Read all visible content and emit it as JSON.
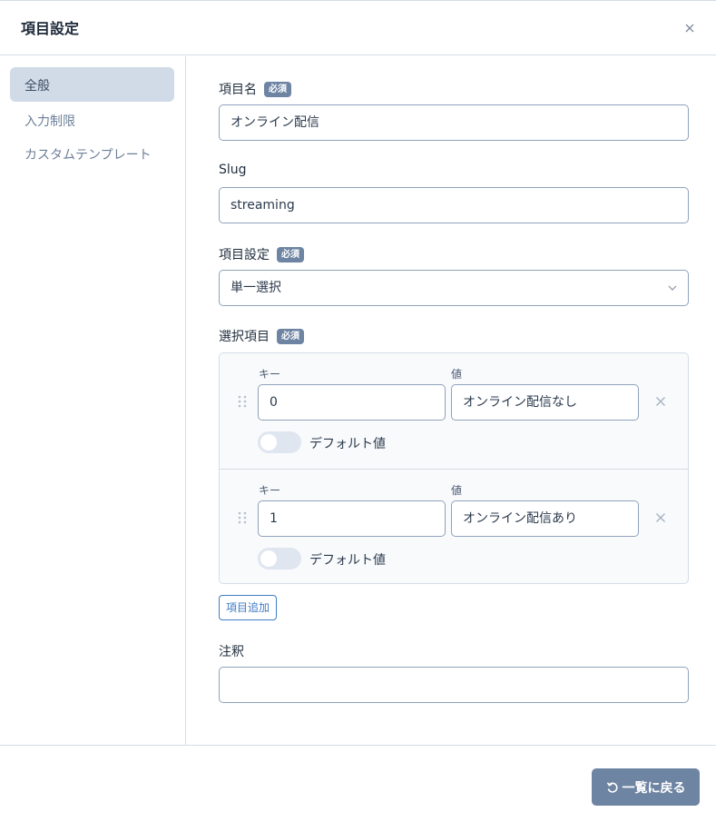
{
  "modal": {
    "title": "項目設定"
  },
  "sidebar": {
    "items": [
      {
        "label": "全般",
        "active": true
      },
      {
        "label": "入力制限",
        "active": false
      },
      {
        "label": "カスタムテンプレート",
        "active": false
      }
    ]
  },
  "form": {
    "required_badge": "必須",
    "item_name": {
      "label": "項目名",
      "value": "オンライン配信"
    },
    "slug": {
      "label": "Slug",
      "value": "streaming"
    },
    "item_type": {
      "label": "項目設定",
      "value": "単一選択"
    },
    "choices": {
      "label": "選択項目",
      "key_label": "キー",
      "value_label": "値",
      "default_label": "デフォルト値",
      "rows": [
        {
          "key": "0",
          "value": "オンライン配信なし",
          "default": false
        },
        {
          "key": "1",
          "value": "オンライン配信あり",
          "default": false
        }
      ],
      "add_button": "項目追加"
    },
    "note": {
      "label": "注釈",
      "value": ""
    }
  },
  "footer": {
    "back_button": "一覧に戻る"
  }
}
